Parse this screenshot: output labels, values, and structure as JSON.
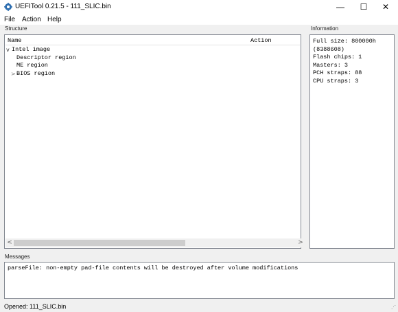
{
  "window": {
    "title": "UEFITool 0.21.5 - 111_SLIC.bin",
    "minimize_glyph": "—",
    "maximize_glyph": "☐",
    "close_glyph": "✕"
  },
  "menubar": {
    "items": [
      "File",
      "Action",
      "Help"
    ]
  },
  "structure": {
    "label": "Structure",
    "columns": [
      "Name",
      "Action"
    ],
    "rows": [
      {
        "label": "Intel image",
        "expander": "v"
      },
      {
        "label": "Descriptor region",
        "expander": ""
      },
      {
        "label": "ME region",
        "expander": ""
      },
      {
        "label": "BIOS region",
        "expander": ">"
      }
    ]
  },
  "information": {
    "label": "Information",
    "lines": [
      "Full size: 800000h",
      "(8388608)",
      "Flash chips: 1",
      "Masters: 3",
      "PCH straps: 88",
      "CPU straps: 3"
    ]
  },
  "messages": {
    "label": "Messages",
    "lines": [
      "parseFile: non-empty pad-file contents will be destroyed after volume modifications"
    ]
  },
  "statusbar": {
    "text": "Opened: 111_SLIC.bin"
  },
  "colors": {
    "app_icon": "#2f6fb0",
    "panel_border": "#828790",
    "background": "#f0f0f0"
  }
}
